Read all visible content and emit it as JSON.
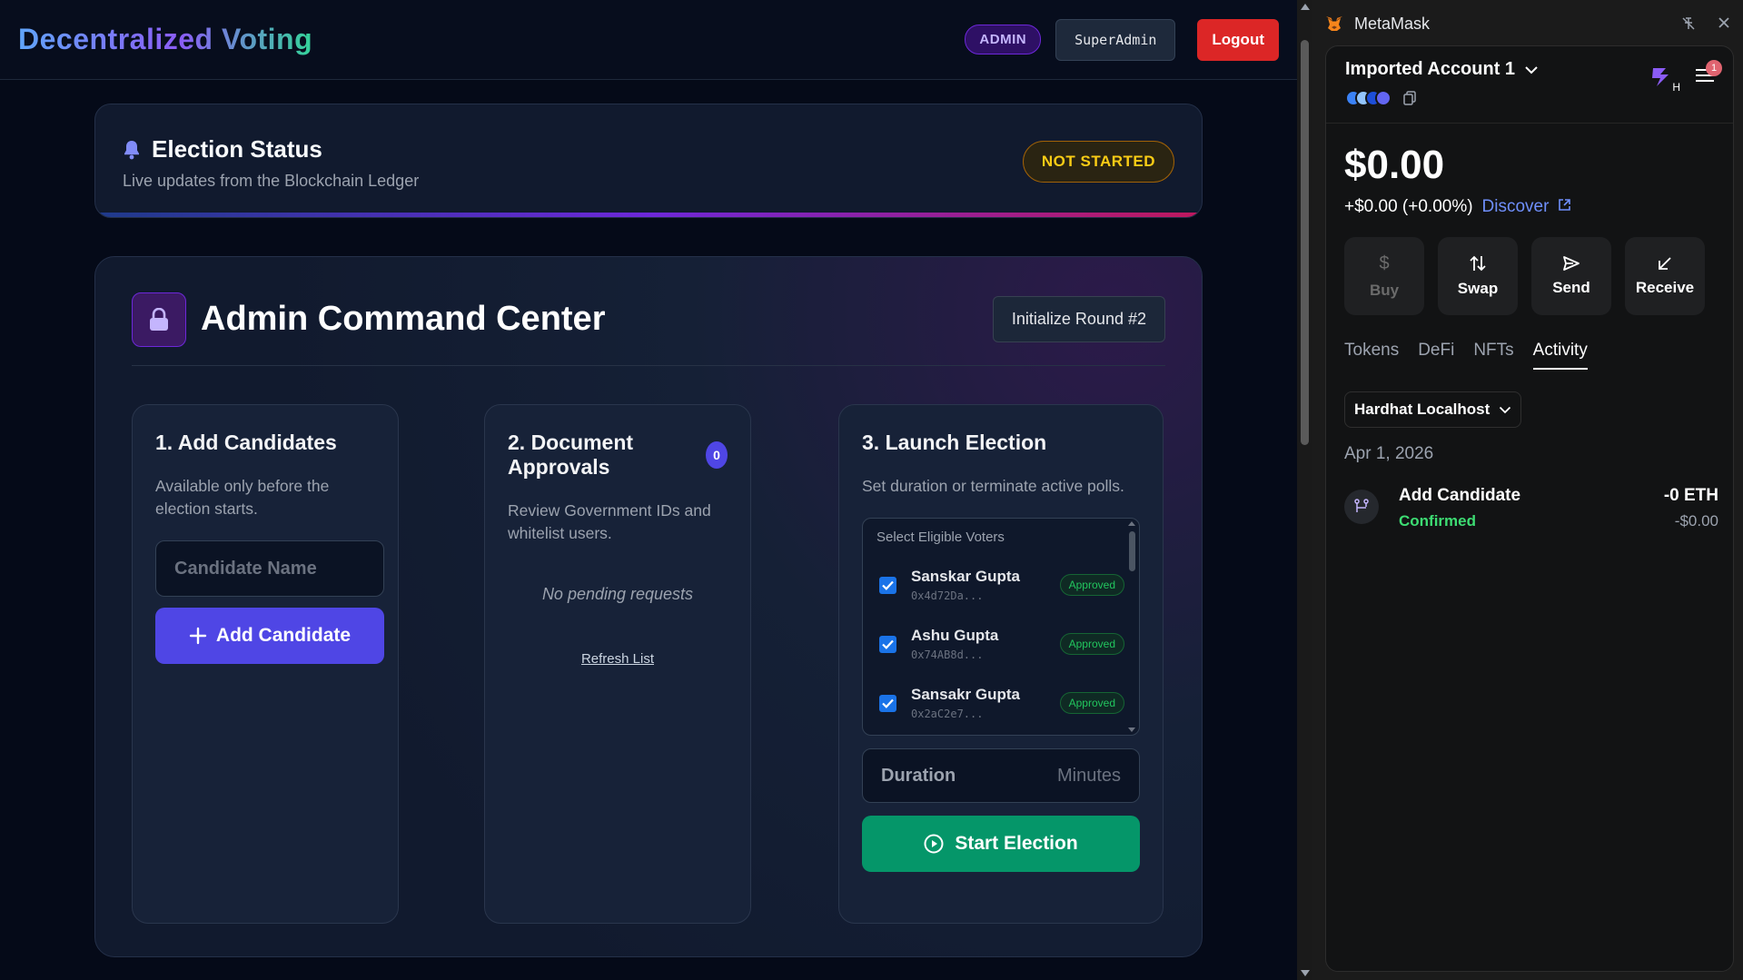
{
  "app": {
    "brand": "Decentralized Voting",
    "role_badge": "ADMIN",
    "user_name": "SuperAdmin",
    "logout_label": "Logout"
  },
  "election_status": {
    "title": "Election Status",
    "subtitle": "Live updates from the Blockchain Ledger",
    "state": "NOT STARTED"
  },
  "command_center": {
    "title": "Admin Command Center",
    "init_button": "Initialize Round #2",
    "add_candidates": {
      "title": "1. Add Candidates",
      "description": "Available only before the election starts.",
      "input_placeholder": "Candidate Name",
      "button_label": "Add Candidate"
    },
    "approvals": {
      "title": "2. Document Approvals",
      "count": "0",
      "description": "Review Government IDs and whitelist users.",
      "empty_text": "No pending requests",
      "refresh_label": "Refresh List"
    },
    "launch": {
      "title": "3. Launch Election",
      "description": "Set duration or terminate active polls.",
      "voters_label": "Select Eligible Voters",
      "voters": [
        {
          "name": "Sanskar Gupta",
          "address": "0x4d72Da...",
          "status": "Approved",
          "checked": true
        },
        {
          "name": "Ashu Gupta",
          "address": "0x74AB8d...",
          "status": "Approved",
          "checked": true
        },
        {
          "name": "Sansakr Gupta",
          "address": "0x2aC2e7...",
          "status": "Approved",
          "checked": true
        }
      ],
      "duration_label": "Duration",
      "duration_unit": "Minutes",
      "start_button": "Start Election"
    }
  },
  "metamask": {
    "window_title": "MetaMask",
    "account_name": "Imported Account 1",
    "notification_count": "1",
    "avatar_letter": "H",
    "balance": "$0.00",
    "change": "+$0.00 (+0.00%)",
    "discover_label": "Discover",
    "actions": [
      {
        "label": "Buy",
        "icon": "dollar-icon",
        "enabled": false
      },
      {
        "label": "Swap",
        "icon": "swap-icon",
        "enabled": true
      },
      {
        "label": "Send",
        "icon": "send-icon",
        "enabled": true
      },
      {
        "label": "Receive",
        "icon": "receive-icon",
        "enabled": true
      }
    ],
    "tabs": [
      "Tokens",
      "DeFi",
      "NFTs",
      "Activity"
    ],
    "active_tab": "Activity",
    "network": "Hardhat Localhost",
    "date": "Apr 1, 2026",
    "transaction": {
      "title": "Add Candidate",
      "status": "Confirmed",
      "amount": "-0 ETH",
      "fiat": "-$0.00"
    }
  },
  "colors": {
    "accent_purple": "#4f46e5",
    "success_green": "#059669",
    "danger_red": "#dc2626",
    "warning_yellow": "#facc15",
    "metamask_link": "#6f8ffb"
  }
}
